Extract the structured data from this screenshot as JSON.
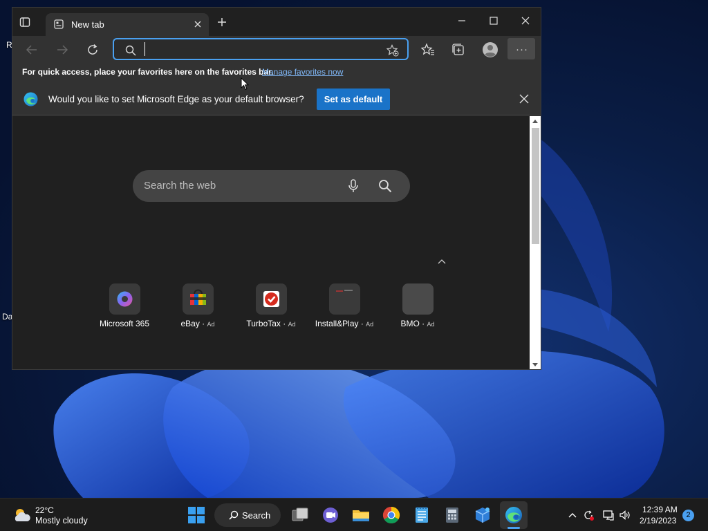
{
  "desktop": {
    "icon_fragments": [
      "Re",
      "Da"
    ]
  },
  "browser": {
    "tab": {
      "title": "New tab"
    },
    "address_bar": {
      "value": "",
      "placeholder": ""
    },
    "favorites_bar": {
      "message": "For quick access, place your favorites here on the favorites bar.",
      "link": "Manage favorites now"
    },
    "infobar": {
      "message": "Would you like to set Microsoft Edge as your default browser?",
      "button": "Set as default"
    },
    "new_tab_page": {
      "search_placeholder": "Search the web",
      "tiles": [
        {
          "label": "Microsoft 365",
          "ad": ""
        },
        {
          "label": "eBay",
          "ad": "Ad"
        },
        {
          "label": "TurboTax",
          "ad": "Ad"
        },
        {
          "label": "Install&Play",
          "ad": "Ad"
        },
        {
          "label": "BMO",
          "ad": "Ad"
        }
      ]
    }
  },
  "taskbar": {
    "weather": {
      "temp": "22°C",
      "desc": "Mostly cloudy"
    },
    "search_label": "Search",
    "clock": {
      "time": "12:39 AM",
      "date": "2/19/2023"
    },
    "notification_count": "2"
  },
  "colors": {
    "accent": "#4aa0f0",
    "set_default_button": "#1a73c8",
    "link": "#7fb6f5"
  }
}
